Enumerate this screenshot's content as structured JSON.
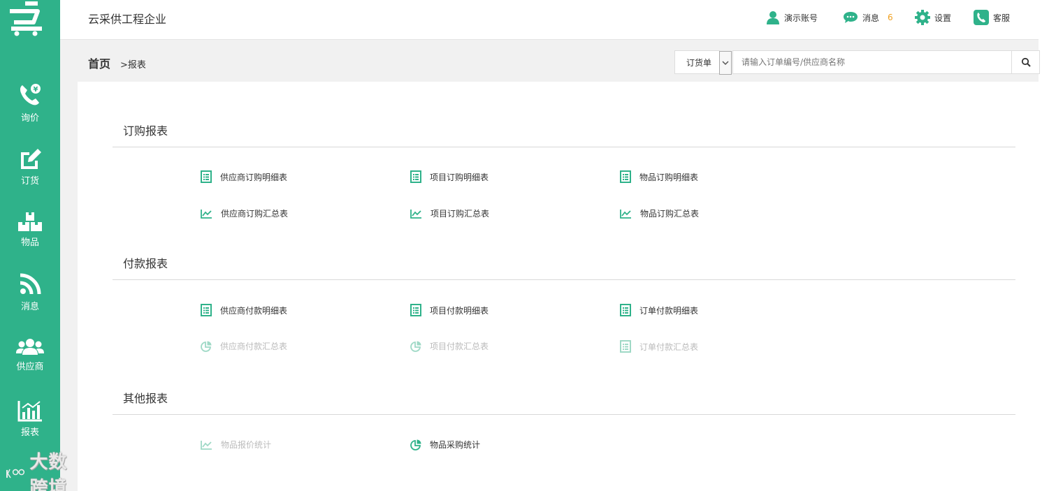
{
  "header": {
    "company": "云采供工程企业",
    "account_label": "演示账号",
    "messages_label": "消息",
    "messages_count": "6",
    "settings_label": "设置",
    "support_label": "客服"
  },
  "sidebar": {
    "items": [
      {
        "label": "询价",
        "icon": "phone-yen-icon"
      },
      {
        "label": "订货",
        "icon": "edit-icon"
      },
      {
        "label": "物品",
        "icon": "boxes-icon"
      },
      {
        "label": "消息",
        "icon": "rss-icon"
      },
      {
        "label": "供应商",
        "icon": "users-icon"
      },
      {
        "label": "报表",
        "icon": "bar-chart-icon"
      }
    ],
    "watermark": "大数跨境"
  },
  "breadcrumb": {
    "home": "首页",
    "current": ">报表"
  },
  "search": {
    "select_value": "订货单",
    "placeholder": "请输入订单编号/供应商名称"
  },
  "sections": [
    {
      "title": "订购报表",
      "rows": [
        [
          {
            "label": "供应商订购明细表",
            "icon": "document-icon",
            "enabled": true
          },
          {
            "label": "项目订购明细表",
            "icon": "document-icon",
            "enabled": true
          },
          {
            "label": "物品订购明细表",
            "icon": "document-icon",
            "enabled": true
          }
        ],
        [
          {
            "label": "供应商订购汇总表",
            "icon": "line-chart-icon",
            "enabled": true
          },
          {
            "label": "项目订购汇总表",
            "icon": "line-chart-icon",
            "enabled": true
          },
          {
            "label": "物品订购汇总表",
            "icon": "line-chart-icon",
            "enabled": true
          }
        ]
      ]
    },
    {
      "title": "付款报表",
      "rows": [
        [
          {
            "label": "供应商付款明细表",
            "icon": "document-icon",
            "enabled": true
          },
          {
            "label": "项目付款明细表",
            "icon": "document-icon",
            "enabled": true
          },
          {
            "label": "订单付款明细表",
            "icon": "document-icon",
            "enabled": true
          }
        ],
        [
          {
            "label": "供应商付款汇总表",
            "icon": "pie-chart-icon",
            "enabled": false
          },
          {
            "label": "项目付款汇总表",
            "icon": "pie-chart-icon",
            "enabled": false
          },
          {
            "label": "订单付款汇总表",
            "icon": "document-icon",
            "enabled": false
          }
        ]
      ]
    },
    {
      "title": "其他报表",
      "rows": [
        [
          {
            "label": "物品报价统计",
            "icon": "line-chart-icon",
            "enabled": false
          },
          {
            "label": "物品采购统计",
            "icon": "pie-chart-icon",
            "enabled": true
          }
        ]
      ]
    }
  ],
  "colors": {
    "brand": "#2fb28a",
    "badge": "#f0a020",
    "disabled_text": "#bbbbbb"
  }
}
